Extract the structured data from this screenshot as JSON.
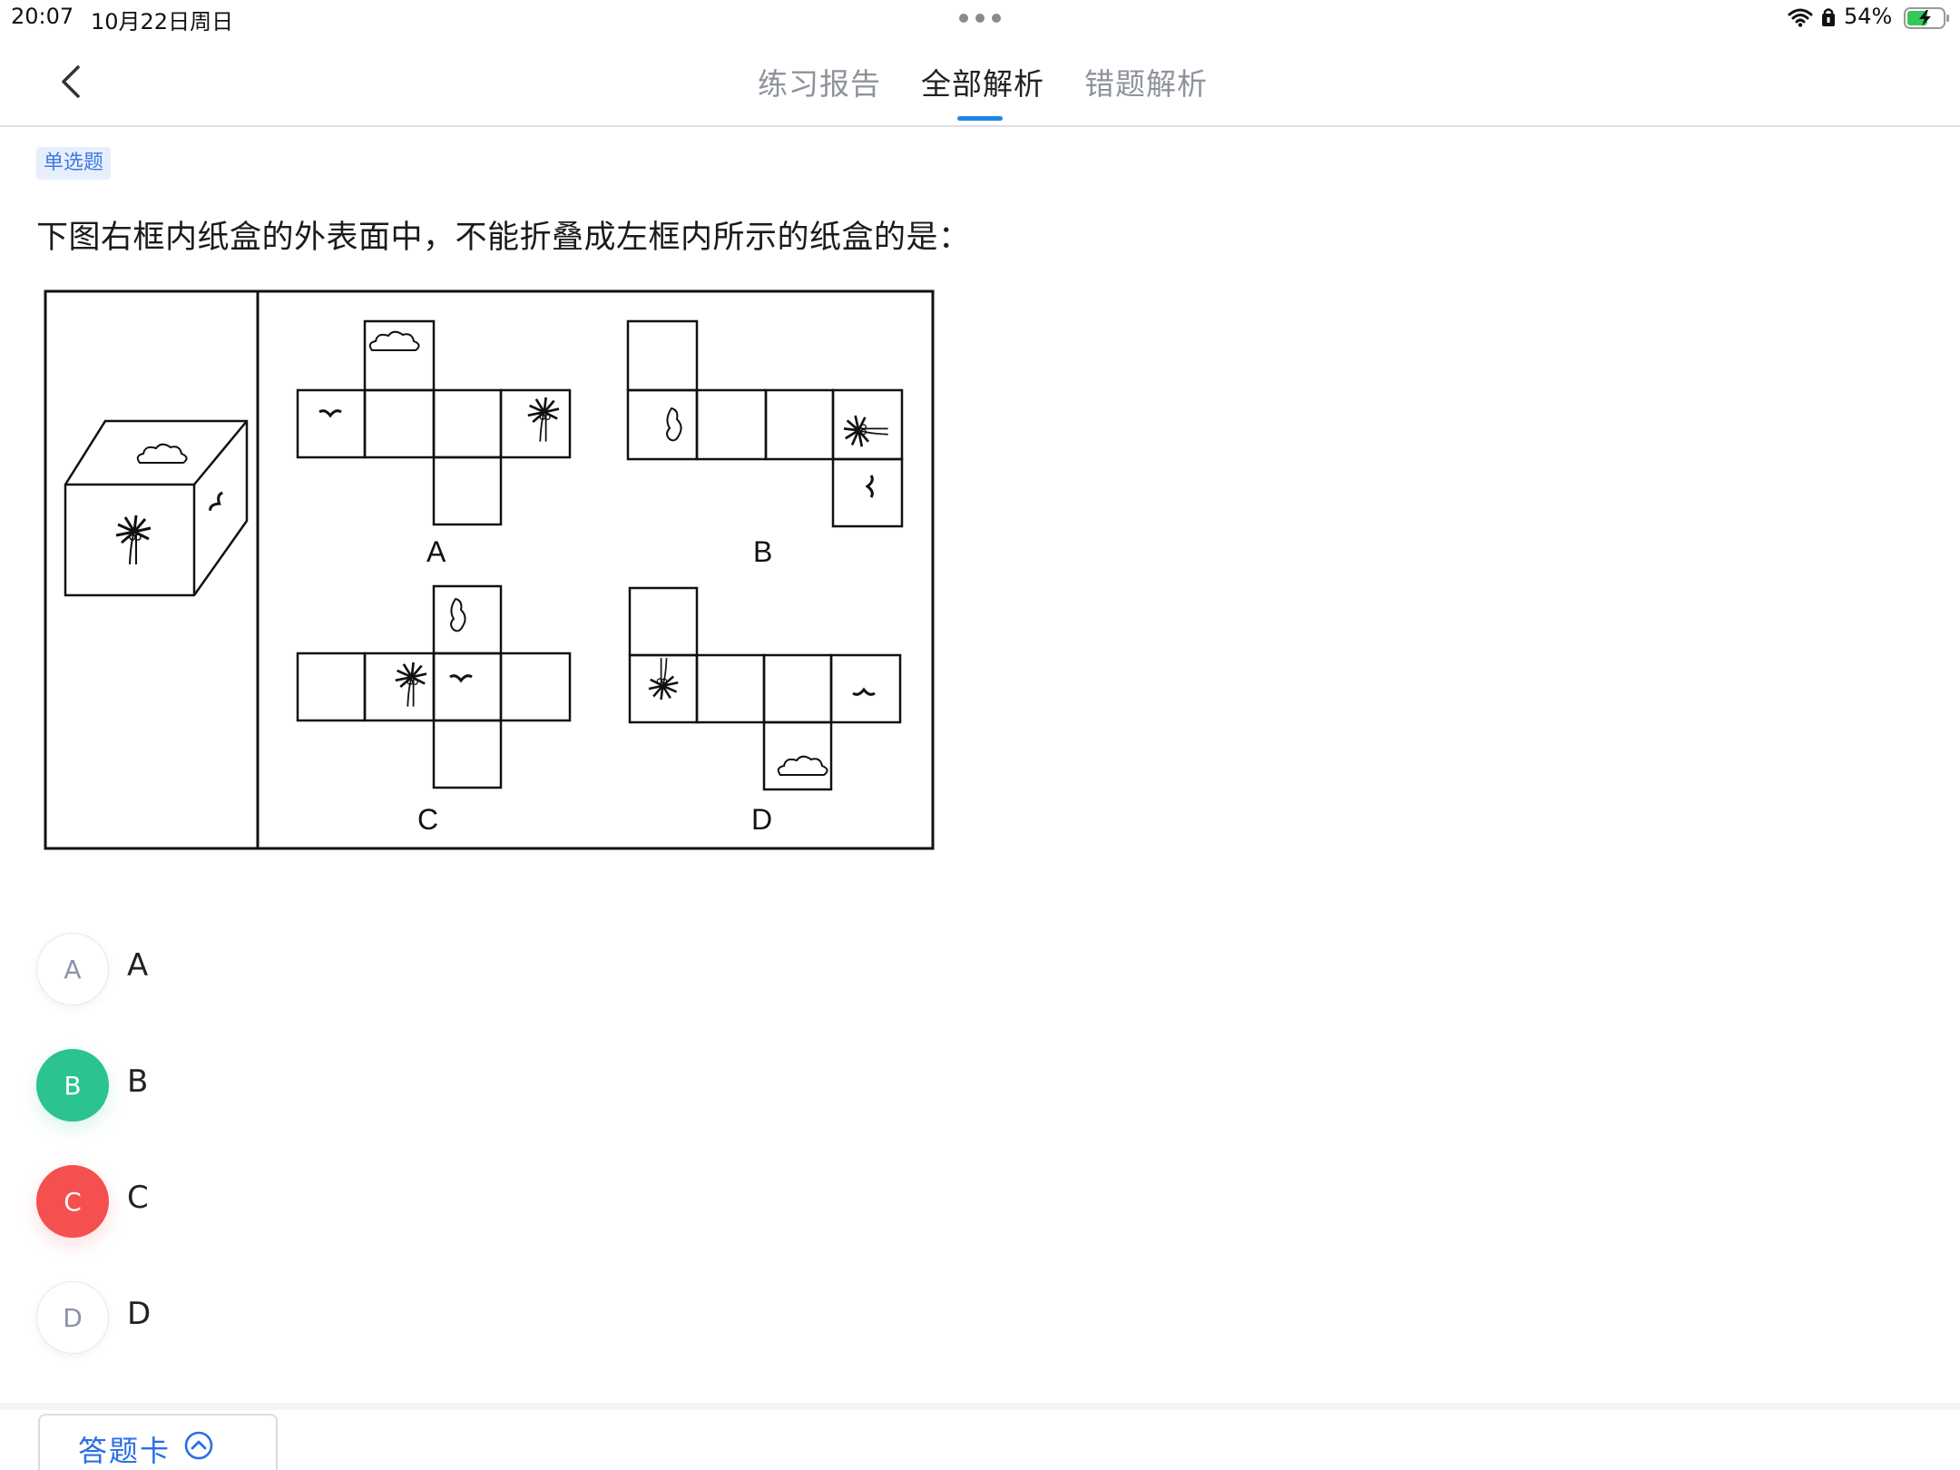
{
  "status_bar": {
    "time": "20:07",
    "date": "10月22日周日",
    "battery_percent": "54%"
  },
  "nav": {
    "tabs": [
      {
        "label": "练习报告",
        "active": false
      },
      {
        "label": "全部解析",
        "active": true
      },
      {
        "label": "错题解析",
        "active": false
      }
    ]
  },
  "question": {
    "type_badge": "单选题",
    "text": "下图右框内纸盒的外表面中，不能折叠成左框内所示的纸盒的是：",
    "figure_labels": [
      "A",
      "B",
      "C",
      "D"
    ]
  },
  "options": [
    {
      "key": "A",
      "text": "A",
      "state": "normal"
    },
    {
      "key": "B",
      "text": "B",
      "state": "correct"
    },
    {
      "key": "C",
      "text": "C",
      "state": "wrong"
    },
    {
      "key": "D",
      "text": "D",
      "state": "normal"
    }
  ],
  "bottom": {
    "answer_card_label": "答题卡"
  },
  "colors": {
    "correct": "#2bc38f",
    "wrong": "#f4504f",
    "accent": "#1e88e5",
    "badge_bg": "#e7effd"
  },
  "icons": [
    "back-icon",
    "wifi-icon",
    "lock-icon",
    "battery-icon",
    "chevron-up-icon",
    "more-dots-icon"
  ]
}
